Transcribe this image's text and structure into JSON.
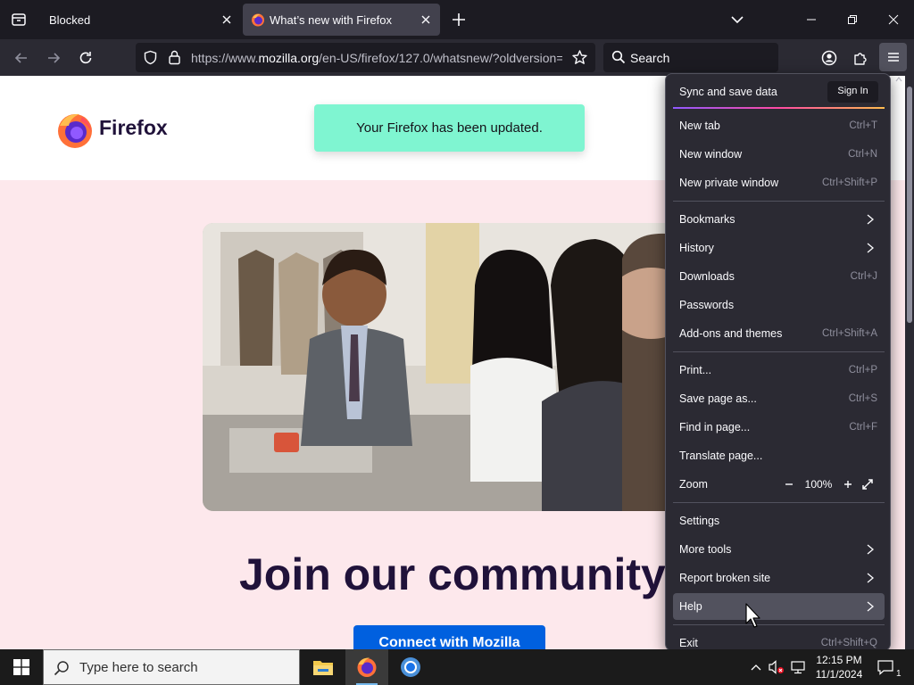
{
  "tabs": [
    {
      "title": "Blocked",
      "active": false
    },
    {
      "title": "What’s new with Firefox",
      "active": true
    }
  ],
  "urlbar": {
    "url_prefix": "https://www.",
    "url_domain": "mozilla.org",
    "url_rest": "/en-US/firefox/127.0/whatsnew/?oldversion="
  },
  "searchbar": {
    "placeholder": "Search"
  },
  "page": {
    "brand": "Firefox",
    "toast": "Your Firefox has been updated.",
    "headline": "Join our community",
    "cta": "Connect with Mozilla"
  },
  "app_menu": {
    "sync_label": "Sync and save data",
    "sign_in": "Sign In",
    "items": [
      {
        "label": "New tab",
        "shortcut": "Ctrl+T"
      },
      {
        "label": "New window",
        "shortcut": "Ctrl+N"
      },
      {
        "label": "New private window",
        "shortcut": "Ctrl+Shift+P"
      },
      {
        "label": "Bookmarks",
        "submenu": true
      },
      {
        "label": "History",
        "submenu": true
      },
      {
        "label": "Downloads",
        "shortcut": "Ctrl+J"
      },
      {
        "label": "Passwords"
      },
      {
        "label": "Add-ons and themes",
        "shortcut": "Ctrl+Shift+A"
      },
      {
        "label": "Print...",
        "shortcut": "Ctrl+P"
      },
      {
        "label": "Save page as...",
        "shortcut": "Ctrl+S"
      },
      {
        "label": "Find in page...",
        "shortcut": "Ctrl+F"
      },
      {
        "label": "Translate page..."
      },
      {
        "label": "Zoom",
        "zoom": "100%"
      },
      {
        "label": "Settings"
      },
      {
        "label": "More tools",
        "submenu": true
      },
      {
        "label": "Report broken site",
        "submenu": true
      },
      {
        "label": "Help",
        "submenu": true,
        "hovered": true
      },
      {
        "label": "Exit",
        "shortcut": "Ctrl+Shift+Q"
      }
    ]
  },
  "taskbar": {
    "search_placeholder": "Type here to search",
    "time": "12:15 PM",
    "date": "11/1/2024",
    "notification_count": "1"
  },
  "colors": {
    "accent": "#0060df",
    "toast": "#7ff5d1",
    "page_bg": "#fde8ec",
    "menu_bg": "#2b2a33"
  }
}
